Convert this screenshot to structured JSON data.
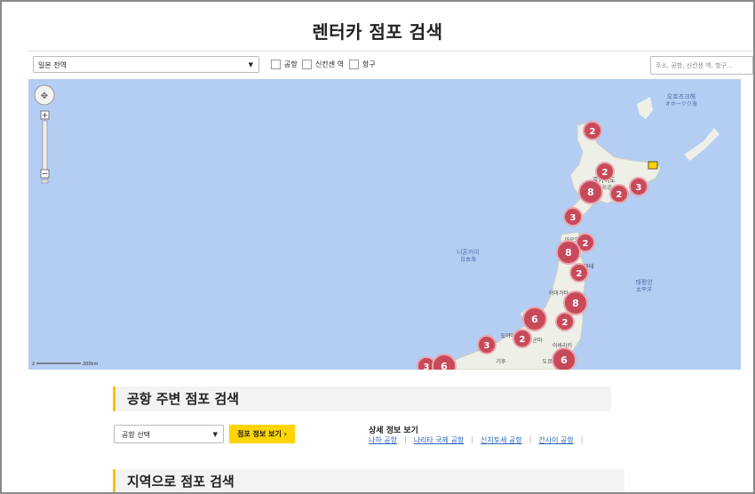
{
  "page": {
    "title": "렌터카 점포 검색"
  },
  "toolbar": {
    "region_select": "일본 전역",
    "checkboxes": [
      {
        "label": "공항"
      },
      {
        "label": "신칸센 역"
      },
      {
        "label": "항구"
      }
    ],
    "search_placeholder": "주소, 공항, 신칸센 역, 항구..."
  },
  "map": {
    "colors": {
      "sea": "#b4cdf2",
      "land": "#eef0e8",
      "cluster": "#c84a5a",
      "grid": "#dde3da"
    },
    "labels": {
      "okhotsk": "오호츠크해",
      "okhotsk_sub": "オホーツク海",
      "hokkaido": "홋카이도",
      "hokkaido_sub": "北海道",
      "japan_sea": "니혼카이",
      "japan_sea_sub": "日本海",
      "pacific": "태평양",
      "pacific_sub": "太平洋",
      "aomori": "아오모",
      "akita": "아키타",
      "iwate": "이와테",
      "yamagata": "야마가타",
      "toyama": "도야마",
      "gunma": "군마",
      "ibaraki": "이바라키",
      "gifu": "기후",
      "tokyo": "도쿄"
    },
    "scale_label": "200km",
    "clusters": [
      {
        "count": 2
      },
      {
        "count": 2
      },
      {
        "count": 8
      },
      {
        "count": 2
      },
      {
        "count": 3
      },
      {
        "count": 3
      },
      {
        "count": 2
      },
      {
        "count": 8
      },
      {
        "count": 2
      },
      {
        "count": 8
      },
      {
        "count": 6
      },
      {
        "count": 2
      },
      {
        "count": 2
      },
      {
        "count": 3
      },
      {
        "count": 6
      },
      {
        "count": 3
      },
      {
        "count": 6
      }
    ]
  },
  "airport_section": {
    "heading": "공항 주변 점포 검색",
    "select_value": "공항 선택",
    "button_label": "점포 정보 보기",
    "button_arrow": "›",
    "detail_title": "상세 정보 보기",
    "links": [
      "나하 공항",
      "나리타 국제 공항",
      "신치토세 공항",
      "간사이 공항"
    ]
  },
  "region_section": {
    "heading": "지역으로 점포 검색"
  }
}
